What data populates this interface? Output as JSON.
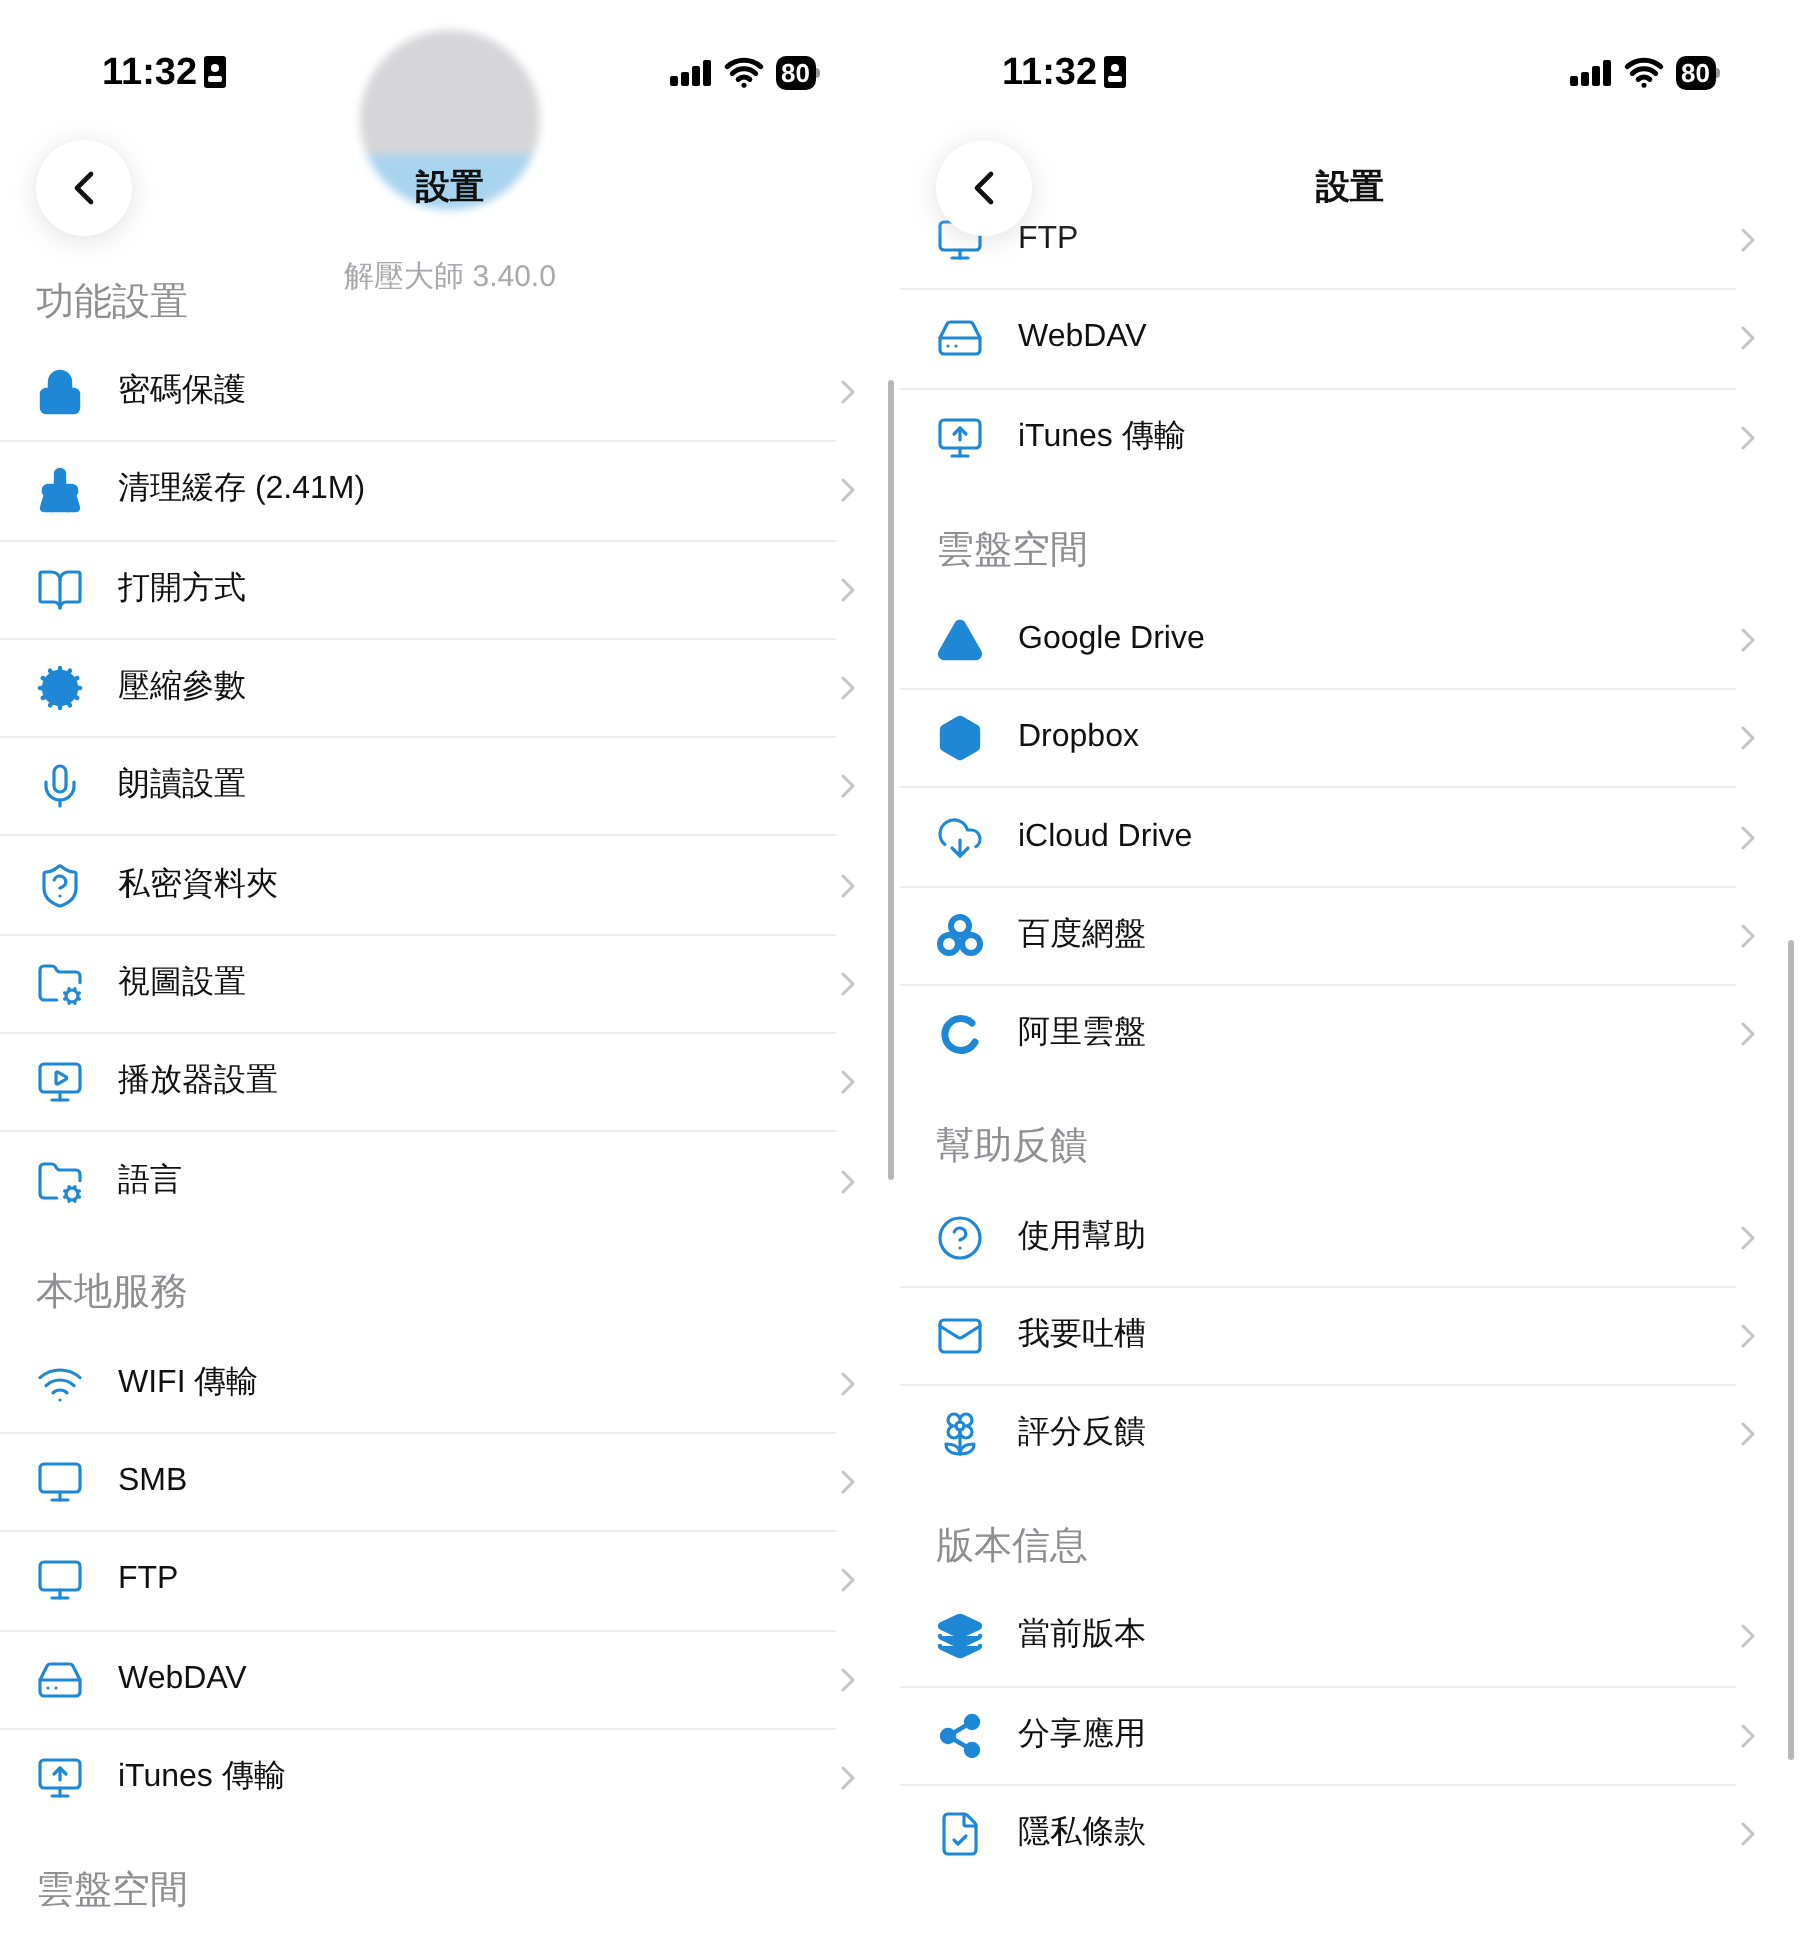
{
  "screens": [
    {
      "status_bar": {
        "time": "11:32",
        "battery": "80"
      },
      "nav": {
        "title": "設置"
      },
      "app_version": "解壓大師 3.40.0",
      "sections": [
        {
          "title": "功能設置",
          "items": [
            {
              "label": "密碼保護"
            },
            {
              "label": "清理緩存 (2.41M)"
            },
            {
              "label": "打開方式"
            },
            {
              "label": "壓縮參數"
            },
            {
              "label": "朗讀設置"
            },
            {
              "label": "私密資料夾"
            },
            {
              "label": "視圖設置"
            },
            {
              "label": "播放器設置"
            },
            {
              "label": "語言"
            }
          ]
        },
        {
          "title": "本地服務",
          "items": [
            {
              "label": "WIFI 傳輸"
            },
            {
              "label": "SMB"
            },
            {
              "label": "FTP"
            },
            {
              "label": "WebDAV"
            },
            {
              "label": "iTunes 傳輸"
            }
          ]
        },
        {
          "title": "雲盤空間"
        }
      ]
    },
    {
      "status_bar": {
        "time": "11:32",
        "battery": "80"
      },
      "nav": {
        "title": "設置"
      },
      "sections": [
        {
          "items": [
            {
              "label": "FTP"
            },
            {
              "label": "WebDAV"
            },
            {
              "label": "iTunes 傳輸"
            }
          ]
        },
        {
          "title": "雲盤空間",
          "items": [
            {
              "label": "Google Drive"
            },
            {
              "label": "Dropbox"
            },
            {
              "label": "iCloud Drive"
            },
            {
              "label": "百度網盤"
            },
            {
              "label": "阿里雲盤"
            }
          ]
        },
        {
          "title": "幫助反饋",
          "items": [
            {
              "label": "使用幫助"
            },
            {
              "label": "我要吐槽"
            },
            {
              "label": "評分反饋"
            }
          ]
        },
        {
          "title": "版本信息",
          "items": [
            {
              "label": "當前版本"
            },
            {
              "label": "分享應用"
            },
            {
              "label": "隱私條款"
            }
          ]
        }
      ]
    }
  ]
}
